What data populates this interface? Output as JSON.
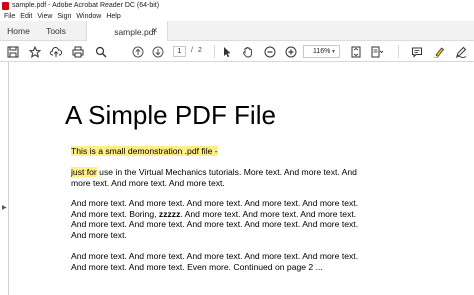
{
  "window": {
    "title": "sample.pdf - Adobe Acrobat Reader DC (64-bit)"
  },
  "menu": {
    "items": [
      "File",
      "Edit",
      "View",
      "Sign",
      "Window",
      "Help"
    ]
  },
  "tabs": {
    "home": "Home",
    "tools": "Tools",
    "document": "sample.pdf"
  },
  "toolbar": {
    "current_page": "1",
    "page_separator": "/",
    "total_pages": "2",
    "zoom": "116%"
  },
  "colors": {
    "highlight": "#ffee86",
    "app_icon": "#d0021b",
    "highlighter_tool": "#e8c800"
  },
  "document": {
    "title": "A Simple PDF File",
    "line1_highlighted": "This is a small demonstration .pdf file -",
    "para2_highlighted": "just for",
    "para2_rest": " use in the Virtual Mechanics tutorials. More text. And more text. And more text. And more text. And more text.",
    "para3_a": "And more text. And more text. And more text. And more text. And more text. And more text. Boring, ",
    "para3_bold": "zzzzz",
    "para3_b": ". And more text. And more text. And more text. And more text. And more text. And more text. And more text. And more text. And more text.",
    "para4": "And more text. And more text. And more text. And more text. And more text. And more text. And more text. Even more. Continued on page 2 ..."
  }
}
